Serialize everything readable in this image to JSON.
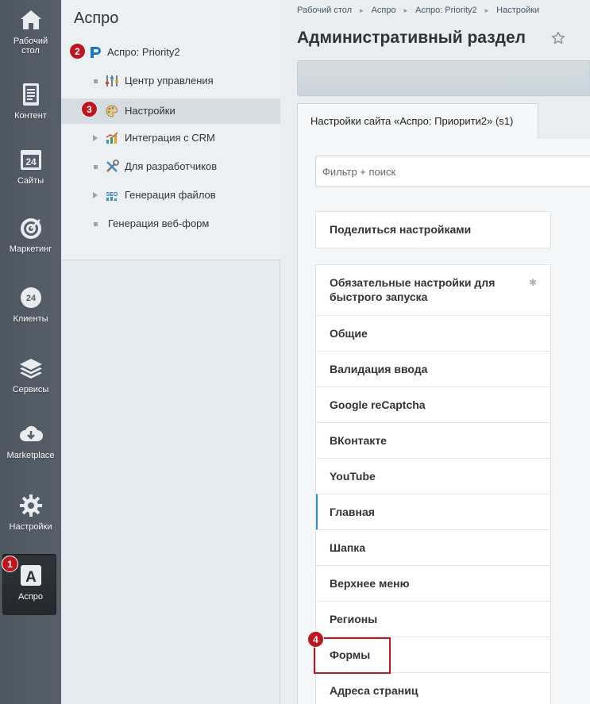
{
  "iconbar": {
    "items": [
      {
        "label": "Рабочий стол",
        "icon": "home-icon"
      },
      {
        "label": "Контент",
        "icon": "document-icon"
      },
      {
        "label": "Сайты",
        "icon": "calendar-24-icon"
      },
      {
        "label": "Маркетинг",
        "icon": "target-icon"
      },
      {
        "label": "Клиенты",
        "icon": "cloud-24-icon"
      },
      {
        "label": "Сервисы",
        "icon": "layers-icon"
      },
      {
        "label": "Marketplace",
        "icon": "cloud-download-icon"
      },
      {
        "label": "Настройки",
        "icon": "gear-icon"
      },
      {
        "label": "Аспро",
        "icon": "letter-a-icon"
      }
    ]
  },
  "badges": {
    "b1": "1",
    "b2": "2",
    "b3": "3",
    "b4": "4"
  },
  "menu": {
    "title": "Аспро",
    "items": [
      {
        "label": "Аспро: Priority2"
      },
      {
        "label": "Центр управления"
      },
      {
        "label": "Настройки"
      },
      {
        "label": "Интеграция с CRM"
      },
      {
        "label": "Для разработчиков"
      },
      {
        "label": "Генерация файлов"
      },
      {
        "label": "Генерация веб-форм"
      }
    ]
  },
  "breadcrumb": [
    "Рабочий стол",
    "Аспро",
    "Аспро: Priority2",
    "Настройки"
  ],
  "page_title": "Административный раздел",
  "tab_label": "Настройки сайта «Аспро: Приорити2» (s1)",
  "filter_placeholder": "Фильтр + поиск",
  "share_label": "Поделиться настройками",
  "sections": [
    "Обязательные настройки для быстрого запуска",
    "Общие",
    "Валидация ввода",
    "Google reCaptcha",
    "ВКонтакте",
    "YouTube",
    "Главная",
    "Шапка",
    "Верхнее меню",
    "Регионы",
    "Формы",
    "Адреса страниц"
  ],
  "colors": {
    "accent": "#2c8fb8",
    "badge": "#c0151c"
  }
}
